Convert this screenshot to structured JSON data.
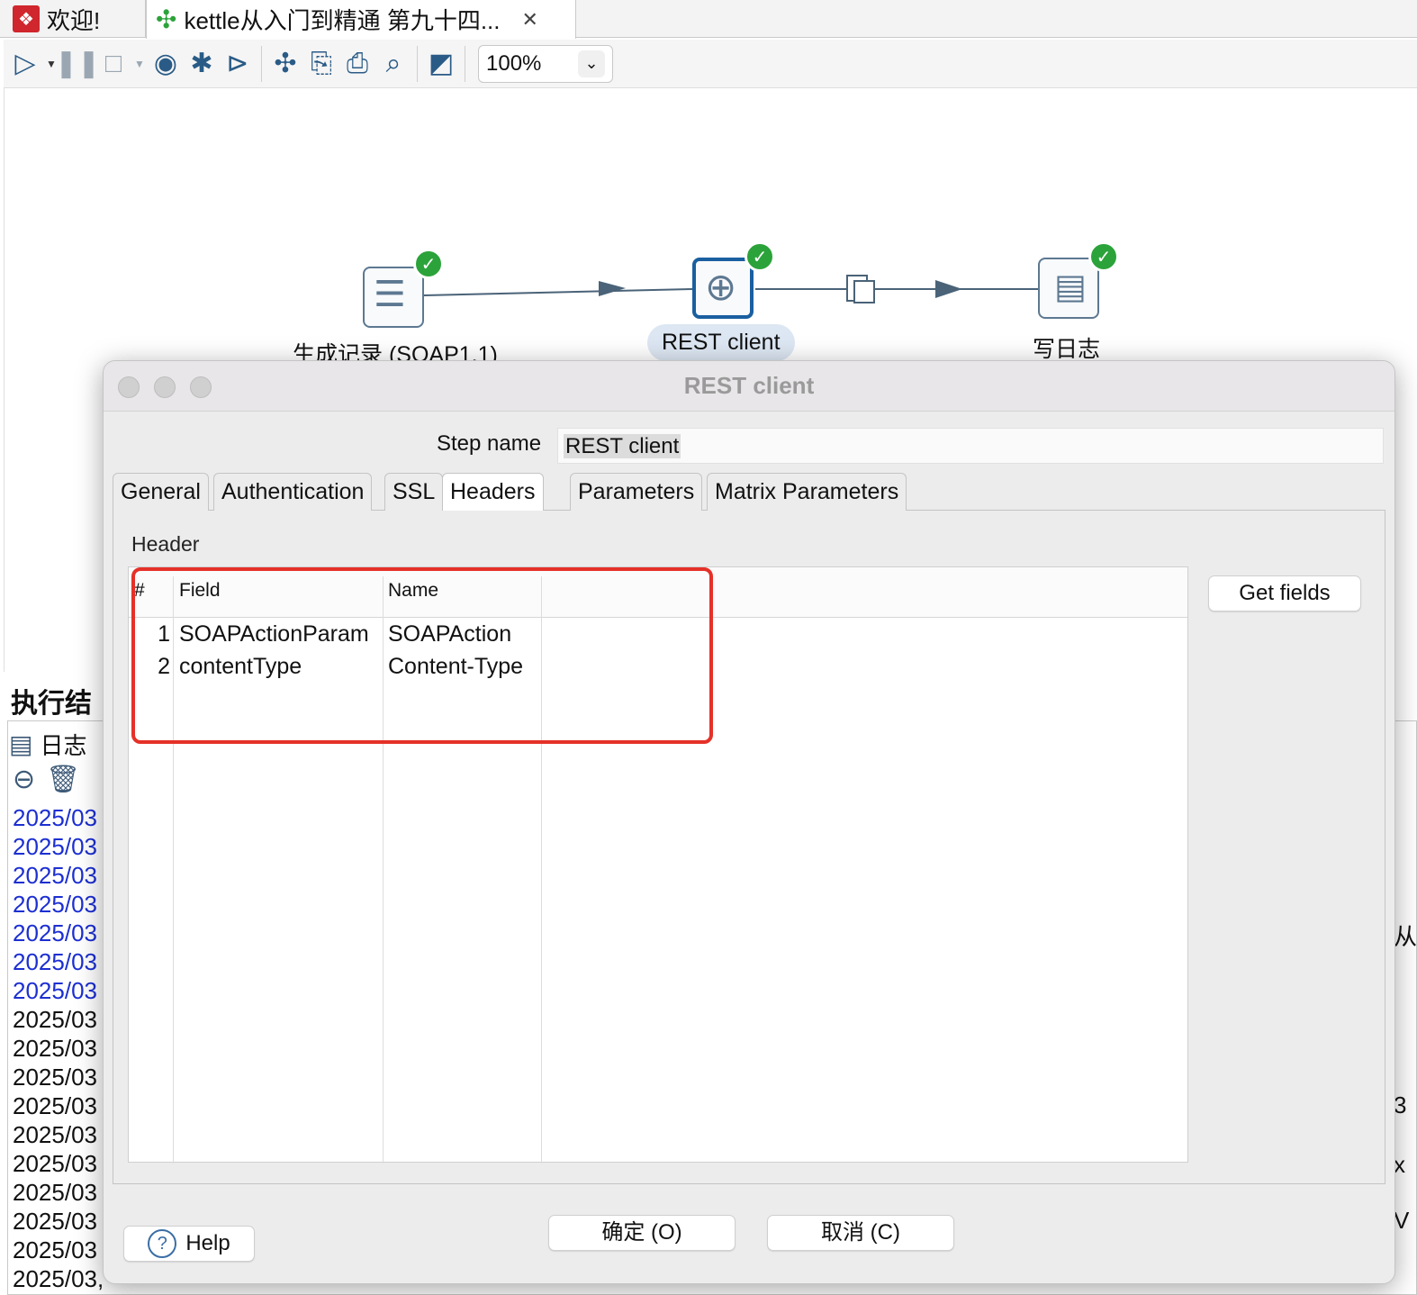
{
  "tabs": {
    "welcome": "欢迎!",
    "transformation": "kettle从入门到精通 第九十四..."
  },
  "toolbar": {
    "zoom": "100%"
  },
  "canvas": {
    "steps": [
      {
        "label": "生成记录 (SOAP1.1)"
      },
      {
        "label": "REST client"
      },
      {
        "label": "写日志"
      }
    ]
  },
  "results": {
    "title": "执行结",
    "log_tab": "日志",
    "log_lines": [
      {
        "text": "2025/03",
        "color": "blue"
      },
      {
        "text": "2025/03",
        "color": "blue"
      },
      {
        "text": "2025/03",
        "color": "blue"
      },
      {
        "text": "2025/03",
        "color": "blue"
      },
      {
        "text": "2025/03",
        "color": "blue"
      },
      {
        "text": "2025/03",
        "color": "blue"
      },
      {
        "text": "2025/03",
        "color": "blue"
      },
      {
        "text": "2025/03",
        "color": "black"
      },
      {
        "text": "2025/03",
        "color": "black"
      },
      {
        "text": "2025/03",
        "color": "black"
      },
      {
        "text": "2025/03",
        "color": "black"
      },
      {
        "text": "2025/03",
        "color": "black"
      },
      {
        "text": "2025/03",
        "color": "black"
      },
      {
        "text": "2025/03",
        "color": "black"
      },
      {
        "text": "2025/03",
        "color": "black"
      },
      {
        "text": "2025/03",
        "color": "black"
      },
      {
        "text": "2025/03,",
        "color": "black"
      }
    ],
    "right_fragments": [
      "从",
      "3",
      "x",
      "V"
    ]
  },
  "dialog": {
    "title": "REST client",
    "step_name_label": "Step name",
    "step_name_value": "REST client",
    "tabs": [
      "General",
      "Authentication",
      "SSL",
      "Headers",
      "Parameters",
      "Matrix Parameters"
    ],
    "active_tab": "Headers",
    "header_section_label": "Header",
    "table": {
      "columns": [
        "#",
        "Field",
        "Name"
      ],
      "rows": [
        {
          "num": "1",
          "field": "SOAPActionParam",
          "name": "SOAPAction"
        },
        {
          "num": "2",
          "field": "contentType",
          "name": "Content-Type"
        }
      ]
    },
    "get_fields_button": "Get fields",
    "help_button": "Help",
    "ok_button": "确定 (O)",
    "cancel_button": "取消 (C)"
  },
  "colors": {
    "highlight_box": "#e53128",
    "check_green": "#2ba33a",
    "log_blue": "#1c2fd2",
    "selected_step_border": "#1a5fa0"
  }
}
